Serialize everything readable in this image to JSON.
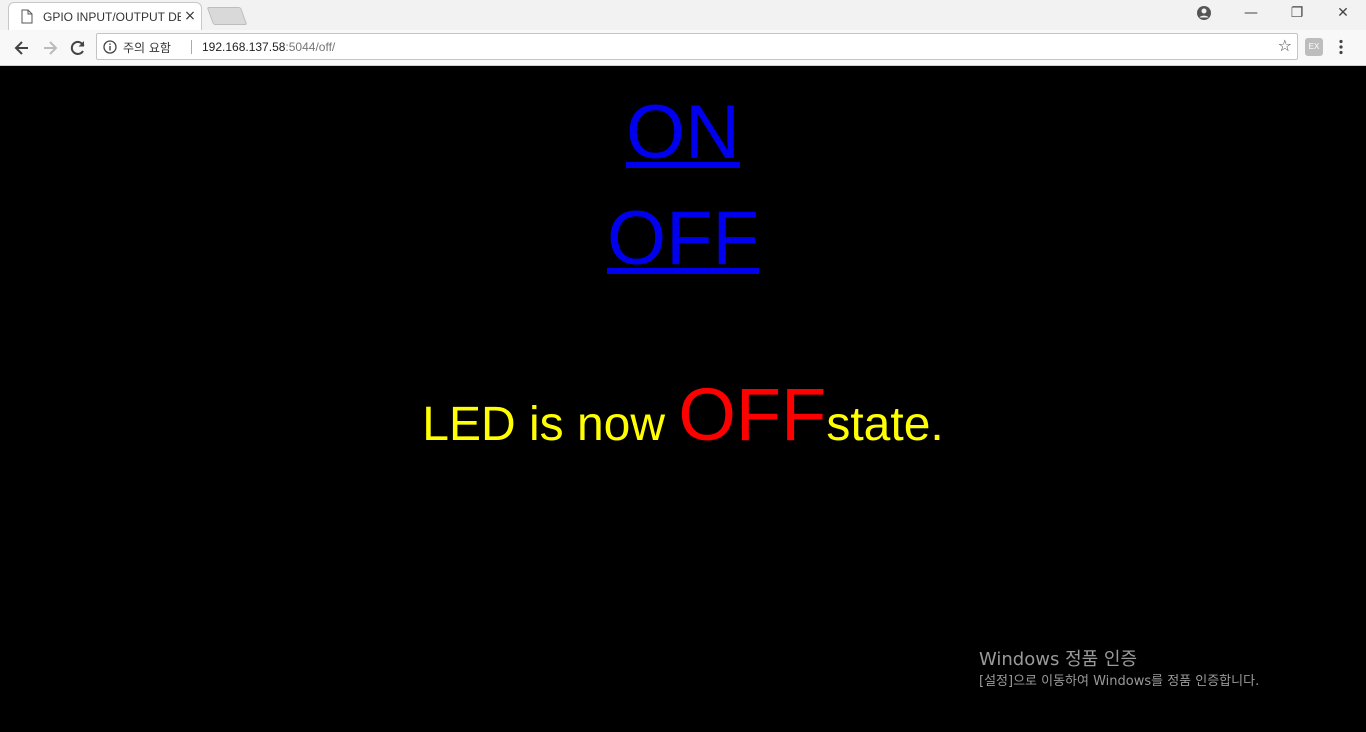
{
  "browser": {
    "tab": {
      "title": "GPIO INPUT/OUTPUT DE",
      "close_label": "×"
    },
    "window_controls": {
      "minimize": "—",
      "restore": "❐",
      "close": "✕"
    },
    "toolbar": {
      "security_label": "주의 요함",
      "url_host": "192.168.137.58",
      "url_path": ":5044/off/",
      "extension_label": "EX"
    }
  },
  "page": {
    "on_link": "ON",
    "off_link": "OFF",
    "status": {
      "prefix": "LED is now ",
      "state": "OFF",
      "suffix": "state."
    },
    "colors": {
      "link": "#0000ee",
      "status_text": "#ffff00",
      "state": "#ff0000",
      "background": "#000000"
    }
  },
  "watermark": {
    "title": "Windows 정품 인증",
    "subtitle": "[설정]으로 이동하여 Windows를 정품 인증합니다."
  }
}
